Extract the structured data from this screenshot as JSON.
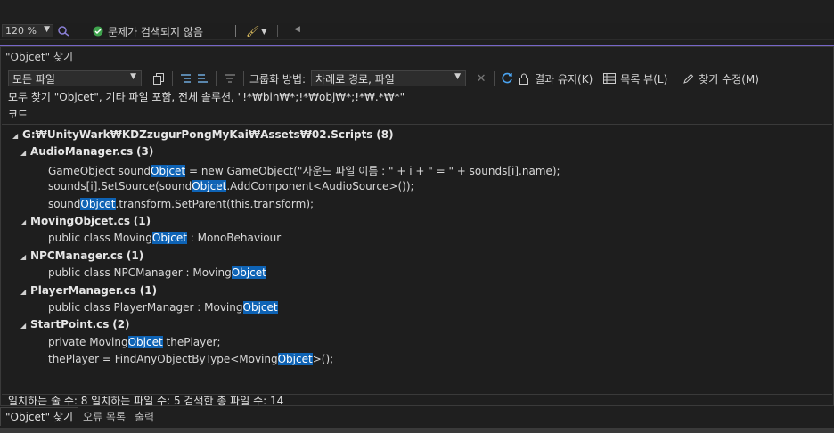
{
  "editor_status": {
    "zoom": "120 %",
    "issues_text": "문제가 검색되지 않음"
  },
  "find_panel": {
    "title": "\"Objcet\" 찾기",
    "scope": "모든 파일",
    "group_label": "그룹화 방법:",
    "group_value": "차례로 경로, 파일",
    "keep_results": "결과 유지(K)",
    "list_view": "목록 뷰(L)",
    "modify_find": "찾기 수정(M)",
    "search_summary": "모두 찾기 \"Objcet\", 기타 파일 포함, 전체 솔루션, \"!*₩bin₩*;!*₩obj₩*;!*₩.*₩*\"",
    "column_header": "코드"
  },
  "results": {
    "root": {
      "path": "G:₩UnityWark₩KDZzugurPongMyKai₩Assets₩02.Scripts",
      "count": "(8)"
    },
    "files": [
      {
        "name": "AudioManager.cs",
        "count": "(3)",
        "lines": [
          {
            "pre": "GameObject sound",
            "match": "Objcet",
            "post": " = new GameObject(\"사운드 파일 이름 : \" + i + \" = \" + sounds[i].name);"
          },
          {
            "pre": "sounds[i].SetSource(sound",
            "match": "Objcet",
            "post": ".AddComponent<AudioSource>());"
          },
          {
            "pre": "sound",
            "match": "Objcet",
            "post": ".transform.SetParent(this.transform);"
          }
        ]
      },
      {
        "name": "MovingObjcet.cs",
        "count": "(1)",
        "lines": [
          {
            "pre": "public class Moving",
            "match": "Objcet",
            "post": " : MonoBehaviour"
          }
        ]
      },
      {
        "name": "NPCManager.cs",
        "count": "(1)",
        "lines": [
          {
            "pre": "public class NPCManager : Moving",
            "match": "Objcet",
            "post": ""
          }
        ]
      },
      {
        "name": "PlayerManager.cs",
        "count": "(1)",
        "lines": [
          {
            "pre": "public class PlayerManager : Moving",
            "match": "Objcet",
            "post": ""
          }
        ]
      },
      {
        "name": "StartPoint.cs",
        "count": "(2)",
        "lines": [
          {
            "pre": "private Moving",
            "match": "Objcet",
            "post": " thePlayer;"
          },
          {
            "pre": "thePlayer = FindAnyObjectByType<Moving",
            "match": "Objcet",
            "post": ">();"
          }
        ]
      }
    ]
  },
  "summary": "일치하는 줄 수: 8 일치하는 파일 수: 5 검색한 총 파일 수: 14",
  "bottom_tabs": [
    "\"Objcet\" 찾기",
    "오류 목록",
    "출력"
  ],
  "colors": {
    "accent": "#7766c7",
    "highlight": "#0e63b5",
    "ok": "#3fa34d"
  },
  "icons": [
    "dropdown-caret-icon",
    "check-circle-icon",
    "brush-icon",
    "collapse-icon",
    "prev-result-icon",
    "next-result-icon",
    "filter-icon",
    "clear-icon",
    "refresh-icon",
    "lock-icon",
    "list-view-icon",
    "pencil-icon",
    "expand-triangle-icon"
  ]
}
